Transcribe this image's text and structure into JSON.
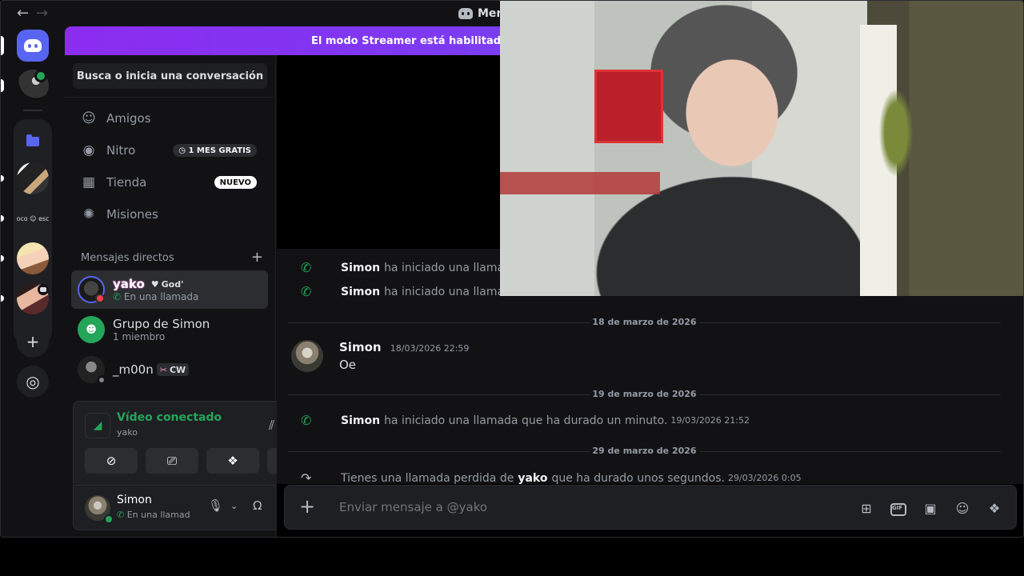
{
  "titlebar": {
    "back_icon": "arrow-left-icon",
    "forward_icon": "arrow-right-icon",
    "title": "Men"
  },
  "banner": {
    "text": "El modo Streamer está habilitado. Los r"
  },
  "sidebar": {
    "search_label": "Busca o inicia una conversación",
    "nav": [
      {
        "label": "Amigos",
        "icon": "friends-icon"
      },
      {
        "label": "Nitro",
        "icon": "nitro-icon",
        "badge": "1 MES GRATIS"
      },
      {
        "label": "Tienda",
        "icon": "shop-icon",
        "badge": "NUEVO"
      },
      {
        "label": "Misiones",
        "icon": "quests-icon"
      }
    ],
    "dm_header": "Mensajes directos",
    "dms": [
      {
        "name": "yako",
        "tag": "God'",
        "sub": "En una llamada"
      },
      {
        "name": "Grupo de Simon",
        "sub": "1 miembro"
      },
      {
        "name": "_m00n",
        "tag": "CW"
      }
    ]
  },
  "servers": {
    "text_server": "oco ☺ esc"
  },
  "voice": {
    "title": "Vídeo conectado",
    "channel": "yako"
  },
  "user": {
    "name": "Simon",
    "status": "En una llamada"
  },
  "chat": {
    "sys1": {
      "name": "Simon",
      "text": "ha iniciado una llamada"
    },
    "sys2": {
      "name": "Simon",
      "text": "ha iniciado una llamada"
    },
    "date1": "18 de marzo de 2026",
    "msg1": {
      "name": "Simon",
      "time": "18/03/2026 22:59",
      "body": "Oe"
    },
    "date2": "19 de marzo de 2026",
    "sys3": {
      "name": "Simon",
      "text": "ha iniciado una llamada que ha durado un minuto.",
      "time": "19/03/2026 21:52"
    },
    "date3": "29 de marzo de 2026",
    "missed": {
      "pre": "Tienes una llamada perdida de",
      "name": "yako",
      "post": "que ha durado unos segundos.",
      "time": "29/03/2026 0:05"
    }
  },
  "composer": {
    "placeholder": "Enviar mensaje a @yako"
  },
  "colors": {
    "accent": "#5865f2",
    "green": "#23a55a",
    "banner_purple": "#8c2cf0"
  }
}
